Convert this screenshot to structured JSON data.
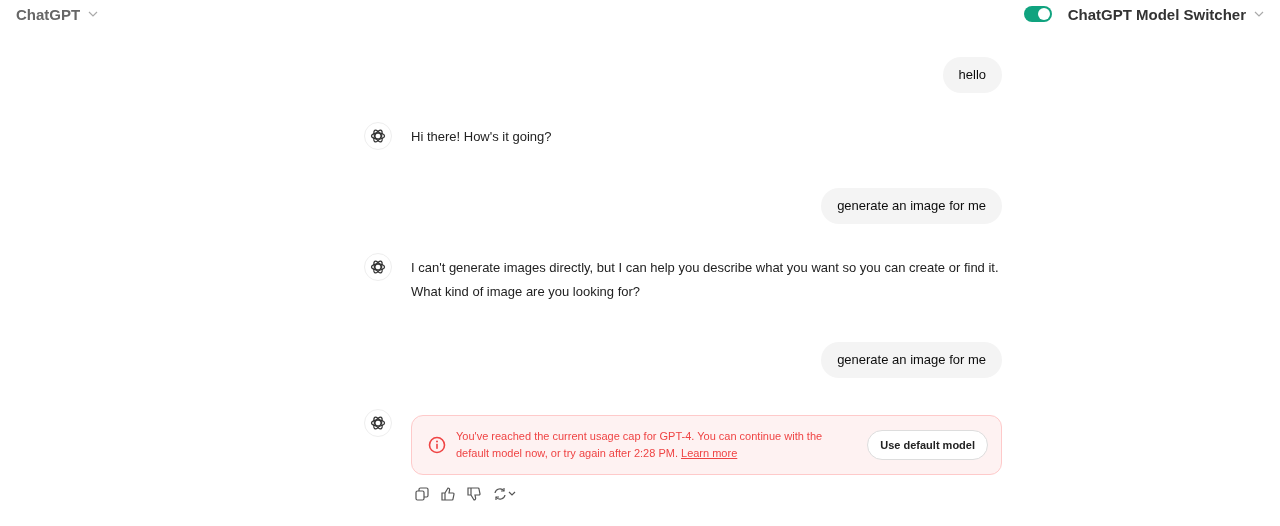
{
  "header": {
    "title": "ChatGPT",
    "extension": {
      "label": "ChatGPT Model Switcher",
      "on": true
    }
  },
  "messages": [
    {
      "kind": "user",
      "text": "hello"
    },
    {
      "kind": "assistant",
      "text": "Hi there! How's it going?"
    },
    {
      "kind": "user",
      "text": "generate an image for me"
    },
    {
      "kind": "assistant",
      "text": "I can't generate images directly, but I can help you describe what you want so you can create or find it. What kind of image are you looking for?"
    },
    {
      "kind": "user",
      "text": "generate an image for me"
    },
    {
      "kind": "error",
      "text": "You've reached the current usage cap for GPT-4. You can continue with the default model now, or try again after 2:28 PM.",
      "link": "Learn more",
      "button": "Use default model"
    }
  ]
}
